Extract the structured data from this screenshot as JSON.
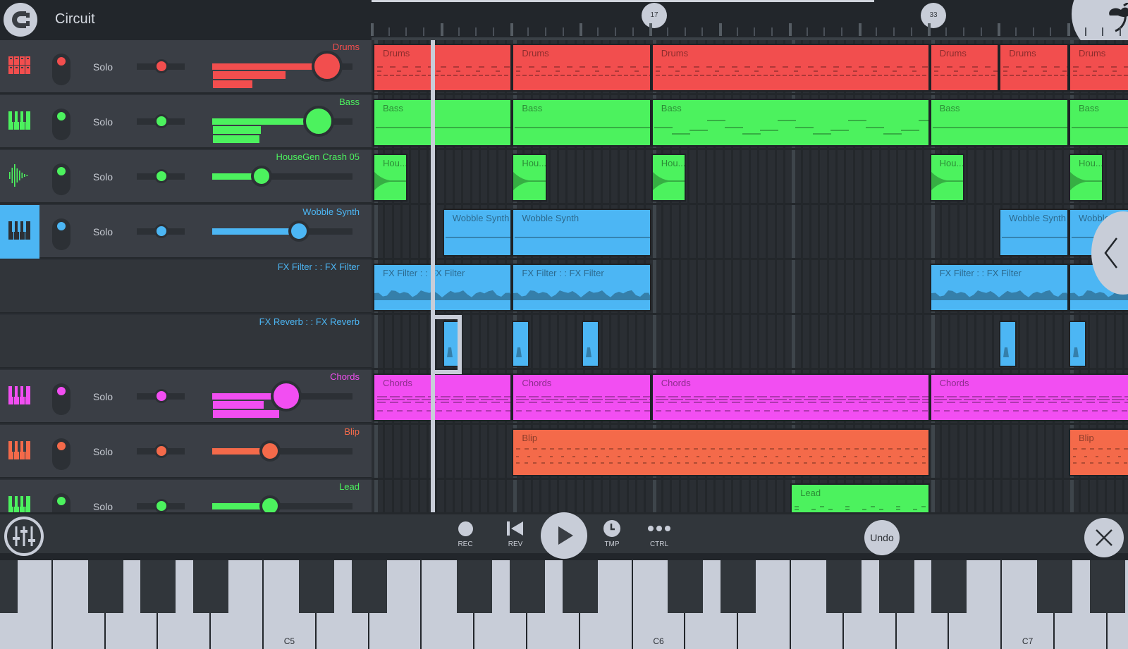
{
  "app": {
    "title": "Circuit"
  },
  "ruler": {
    "markers": [
      "17",
      "33"
    ]
  },
  "channels": [
    {
      "name": "Drums",
      "color": "#f24e4e",
      "icon": "drum-pads-icon",
      "solo_label": "Solo",
      "volume": 0.82,
      "pan": 0.5,
      "meter": [
        0.52,
        0.28
      ],
      "selected": false,
      "type": "instrument"
    },
    {
      "name": "Bass",
      "color": "#4cf25e",
      "icon": "piano-keys-icon",
      "solo_label": "Solo",
      "volume": 0.76,
      "pan": 0.5,
      "meter": [
        0.34,
        0.33
      ],
      "selected": false,
      "type": "instrument"
    },
    {
      "name": "HouseGen Crash 05",
      "color": "#4cf25e",
      "icon": "waveform-icon",
      "solo_label": "Solo",
      "volume": 0.35,
      "pan": 0.5,
      "meter": [],
      "selected": false,
      "type": "instrument"
    },
    {
      "name": "Wobble Synth",
      "color": "#4cb6f4",
      "icon": "piano-keys-icon",
      "solo_label": "Solo",
      "volume": 0.62,
      "pan": 0.5,
      "meter": [],
      "selected": true,
      "type": "instrument"
    },
    {
      "name": "FX Filter :  : FX Filter",
      "color": "#4cb6f4",
      "type": "fx"
    },
    {
      "name": "FX Reverb :  : FX Reverb",
      "color": "#4cb6f4",
      "type": "fx"
    },
    {
      "name": "Chords",
      "color": "#f24ef2",
      "icon": "piano-keys-icon",
      "solo_label": "Solo",
      "volume": 0.53,
      "pan": 0.5,
      "meter": [
        0.36,
        0.47
      ],
      "selected": false,
      "type": "instrument"
    },
    {
      "name": "Blip",
      "color": "#f46a4a",
      "icon": "piano-keys-icon",
      "solo_label": "Solo",
      "volume": 0.41,
      "pan": 0.5,
      "meter": [],
      "selected": false,
      "type": "instrument"
    },
    {
      "name": "Lead",
      "color": "#4cf25e",
      "icon": "piano-keys-icon",
      "solo_label": "Solo",
      "volume": 0.41,
      "pan": 0.5,
      "meter": [],
      "selected": false,
      "type": "instrument"
    }
  ],
  "clips": [
    {
      "lane": 0,
      "label": "Drums",
      "start": 0,
      "len": 4,
      "style": "drums"
    },
    {
      "lane": 0,
      "label": "Drums",
      "start": 4,
      "len": 4,
      "style": "drums"
    },
    {
      "lane": 0,
      "label": "Drums",
      "start": 8,
      "len": 8,
      "style": "drums"
    },
    {
      "lane": 0,
      "label": "Drums",
      "start": 16,
      "len": 2,
      "style": "drums"
    },
    {
      "lane": 0,
      "label": "Drums",
      "start": 18,
      "len": 2,
      "style": "drums"
    },
    {
      "lane": 0,
      "label": "Drums",
      "start": 20,
      "len": 2,
      "style": "drums"
    },
    {
      "lane": 1,
      "label": "Bass",
      "start": 0,
      "len": 4,
      "style": "line"
    },
    {
      "lane": 1,
      "label": "Bass",
      "start": 4,
      "len": 4,
      "style": "line"
    },
    {
      "lane": 1,
      "label": "Bass",
      "start": 8,
      "len": 8,
      "style": "bass"
    },
    {
      "lane": 1,
      "label": "Bass",
      "start": 16,
      "len": 4,
      "style": "line"
    },
    {
      "lane": 1,
      "label": "Bass",
      "start": 20,
      "len": 2,
      "style": "line"
    },
    {
      "lane": 2,
      "label": "Hou...",
      "start": 0,
      "len": 1,
      "style": "crash"
    },
    {
      "lane": 2,
      "label": "Hou...",
      "start": 4,
      "len": 1,
      "style": "crash"
    },
    {
      "lane": 2,
      "label": "Hou...",
      "start": 8,
      "len": 1,
      "style": "crash"
    },
    {
      "lane": 2,
      "label": "Hou...",
      "start": 16,
      "len": 1,
      "style": "crash"
    },
    {
      "lane": 2,
      "label": "Hou...",
      "start": 20,
      "len": 1,
      "style": "crash"
    },
    {
      "lane": 3,
      "label": "Wobble Synth",
      "start": 2,
      "len": 2,
      "style": "line"
    },
    {
      "lane": 3,
      "label": "Wobble Synth",
      "start": 4,
      "len": 4,
      "style": "line"
    },
    {
      "lane": 3,
      "label": "Wobble Synth",
      "start": 18,
      "len": 2,
      "style": "line"
    },
    {
      "lane": 3,
      "label": "Wobble Synth",
      "start": 20,
      "len": 2,
      "style": "line"
    },
    {
      "lane": 4,
      "label": "FX Filter :  : FX Filter",
      "start": 0,
      "len": 4,
      "style": "wave"
    },
    {
      "lane": 4,
      "label": "FX Filter :  : FX Filter",
      "start": 4,
      "len": 4,
      "style": "wave"
    },
    {
      "lane": 4,
      "label": "FX Filter :  : FX Filter",
      "start": 16,
      "len": 4,
      "style": "wave"
    },
    {
      "lane": 4,
      "label": "",
      "start": 20,
      "len": 2,
      "style": "wave"
    },
    {
      "lane": 5,
      "label": "",
      "start": 2,
      "len": 0.5,
      "style": "reverb"
    },
    {
      "lane": 5,
      "label": "",
      "start": 4,
      "len": 0.5,
      "style": "reverb"
    },
    {
      "lane": 5,
      "label": "",
      "start": 6,
      "len": 0.5,
      "style": "reverb"
    },
    {
      "lane": 5,
      "label": "",
      "start": 18,
      "len": 0.5,
      "style": "reverb"
    },
    {
      "lane": 5,
      "label": "",
      "start": 20,
      "len": 0.5,
      "style": "reverb"
    },
    {
      "lane": 6,
      "label": "Chords",
      "start": 0,
      "len": 4,
      "style": "chords"
    },
    {
      "lane": 6,
      "label": "Chords",
      "start": 4,
      "len": 4,
      "style": "chords"
    },
    {
      "lane": 6,
      "label": "Chords",
      "start": 8,
      "len": 8,
      "style": "chords"
    },
    {
      "lane": 6,
      "label": "Chords",
      "start": 16,
      "len": 6,
      "style": "chords"
    },
    {
      "lane": 7,
      "label": "Blip",
      "start": 4,
      "len": 12,
      "style": "blip"
    },
    {
      "lane": 7,
      "label": "Blip",
      "start": 20,
      "len": 2,
      "style": "blip"
    },
    {
      "lane": 8,
      "label": "Lead",
      "start": 12,
      "len": 4,
      "style": "lead"
    }
  ],
  "transport": {
    "rec_label": "REC",
    "rev_label": "REV",
    "tmp_label": "TMP",
    "ctrl_label": "CTRL",
    "undo_label": "Undo"
  },
  "keyboard": {
    "labels": {
      "C5": "C5",
      "C6": "C6",
      "C7": "C7"
    }
  }
}
